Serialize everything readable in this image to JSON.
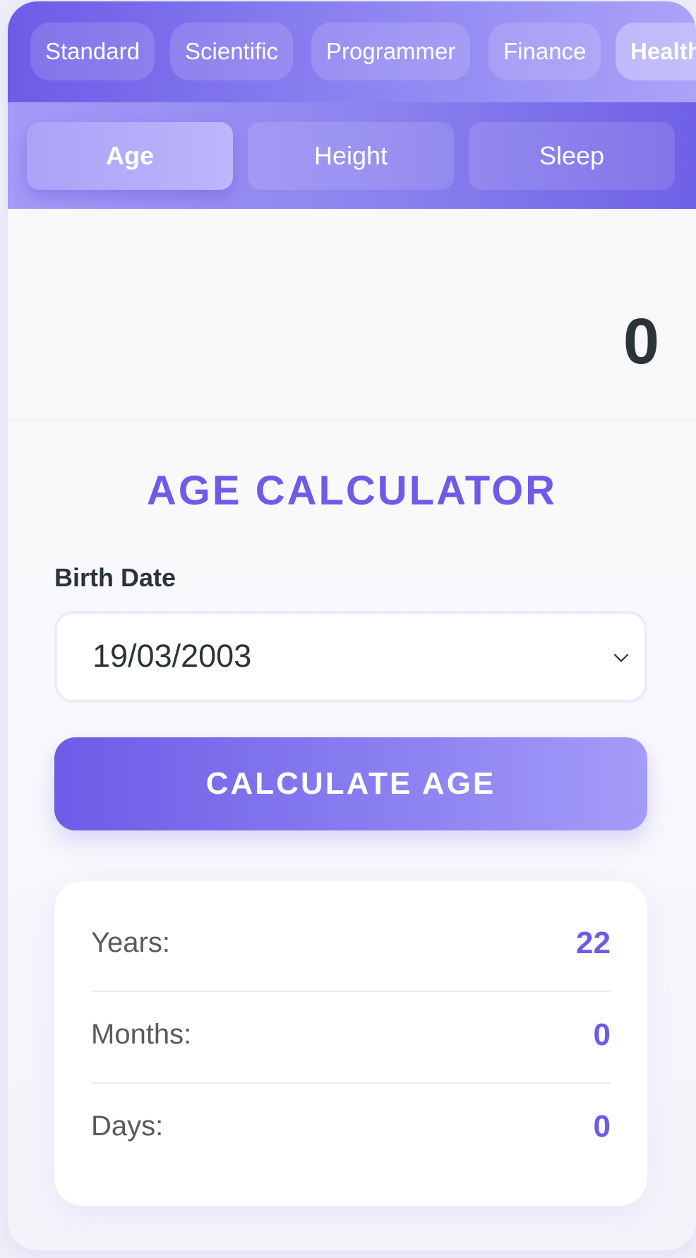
{
  "mode_tabs": [
    {
      "label": "Standard"
    },
    {
      "label": "Scientific"
    },
    {
      "label": "Programmer"
    },
    {
      "label": "Finance"
    },
    {
      "label": "Health"
    }
  ],
  "active_mode": "Health",
  "sub_tabs": [
    {
      "label": "Age"
    },
    {
      "label": "Height"
    },
    {
      "label": "Sleep"
    }
  ],
  "active_sub_tab": "Age",
  "display": {
    "value": "0"
  },
  "calculator": {
    "title": "AGE CALCULATOR",
    "birth_date_label": "Birth Date",
    "birth_date_value": "19/03/2003",
    "button_label": "CALCULATE AGE"
  },
  "results": [
    {
      "label": "Years:",
      "value": "22"
    },
    {
      "label": "Months:",
      "value": "0"
    },
    {
      "label": "Days:",
      "value": "0"
    }
  ],
  "colors": {
    "accent": "#6c5ce7",
    "accent_light": "#a29bfe",
    "text_dark": "#2b3436"
  },
  "icons": {
    "date_dropdown": "chevron-down-icon"
  }
}
